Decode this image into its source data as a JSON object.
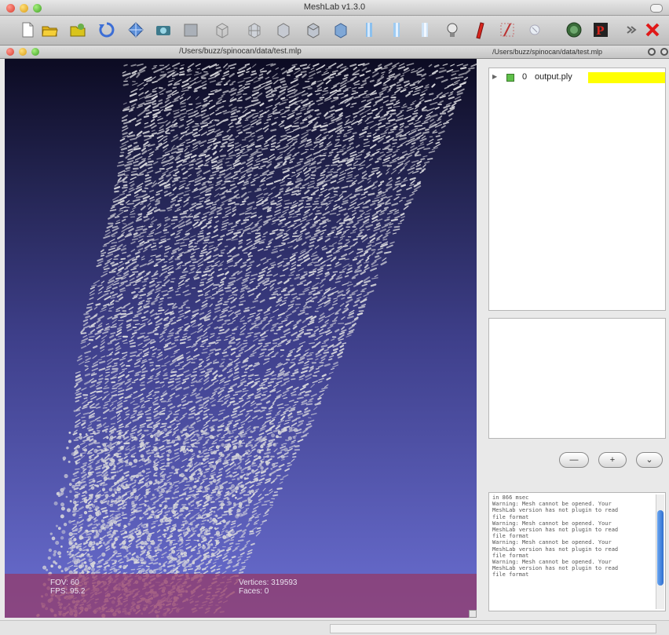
{
  "window": {
    "title": "MeshLab v1.3.0"
  },
  "toolbar": {
    "buttons": [
      {
        "icon": "new-document-icon"
      },
      {
        "icon": "open-folder-icon"
      },
      {
        "icon": "save-folder-icon"
      },
      {
        "icon": "reload-icon"
      },
      {
        "icon": "diamond-icon"
      },
      {
        "icon": "snapshot-icon"
      },
      {
        "icon": "box-points-icon"
      },
      {
        "icon": "box-wire-icon"
      },
      {
        "icon": "box-grid-icon"
      },
      {
        "icon": "box-flat-icon"
      },
      {
        "icon": "box-flatlines-icon"
      },
      {
        "icon": "box-smooth-icon"
      },
      {
        "icon": "texture-1-icon"
      },
      {
        "icon": "texture-2-icon"
      },
      {
        "icon": "texture-3-icon"
      },
      {
        "icon": "light-bulb-icon"
      },
      {
        "icon": "red-tool-icon"
      },
      {
        "icon": "move-icon"
      },
      {
        "icon": "pick-icon"
      },
      {
        "icon": "green-ball-icon"
      },
      {
        "icon": "pp-icon"
      },
      {
        "icon": "more-icon"
      },
      {
        "icon": "close-x-icon"
      }
    ]
  },
  "document": {
    "path": "/Users/buzz/spinocan/data/test.mlp"
  },
  "dock": {
    "path": "/Users/buzz/spinocan/data/test.mlp",
    "layers": [
      {
        "index": "0",
        "name": "output.ply"
      }
    ],
    "buttons": {
      "minus": "—",
      "plus": "+",
      "menu": "⌄"
    }
  },
  "viewport": {
    "info": {
      "fov": "FOV: 60",
      "fps": "FPS:   95.2",
      "vertices": "Vertices: 319593",
      "faces": "Faces: 0"
    }
  },
  "log": [
    "in 866 msec",
    "Warning: Mesh cannot be opened. Your",
    "MeshLab version has not plugin to read",
    "file format",
    "Warning: Mesh cannot be opened. Your",
    "MeshLab version has not plugin to read",
    "file format",
    "Warning: Mesh cannot be opened. Your",
    "MeshLab version has not plugin to read",
    "file format",
    "Warning: Mesh cannot be opened. Your",
    "MeshLab version has not plugin to read",
    "file format"
  ],
  "colors": {
    "layer_highlight": "#ffff00",
    "info_bar": "#96376a",
    "viewport_bottom": "#6a6ed1",
    "viewport_top": "#0c0b22"
  }
}
